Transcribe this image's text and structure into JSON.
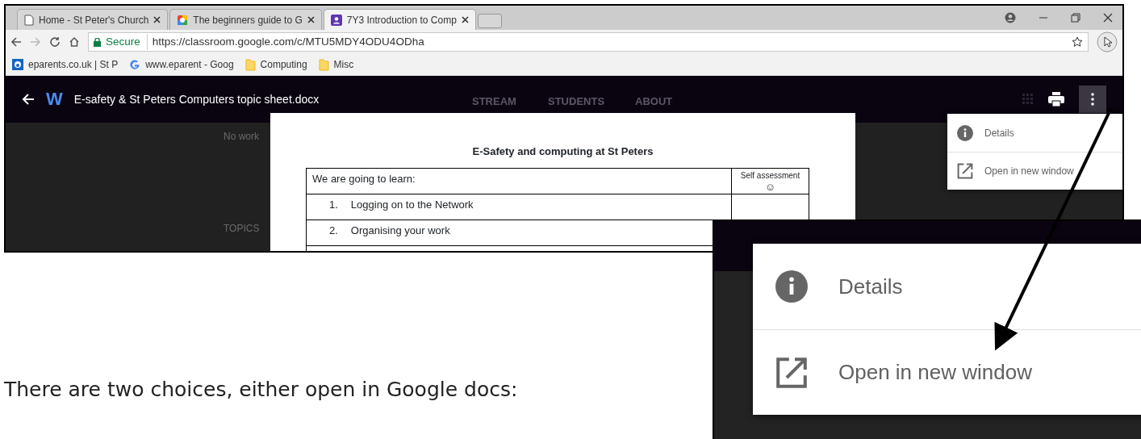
{
  "browser": {
    "tabs": [
      {
        "title": "Home - St Peter's Church",
        "kind": "page",
        "selected": false
      },
      {
        "title": "The beginners guide to G",
        "kind": "logo",
        "selected": false
      },
      {
        "title": "7Y3 Introduction to Comp",
        "kind": "classroom",
        "selected": true
      }
    ],
    "secure_label": "Secure",
    "url": "https://classroom.google.com/c/MTU5MDY4ODU4ODha",
    "bookmarks": [
      {
        "label": "eparents.co.uk | St P",
        "kind": "site"
      },
      {
        "label": "www.eparent - Goog",
        "kind": "google"
      },
      {
        "label": "Computing",
        "kind": "folder"
      },
      {
        "label": "Misc",
        "kind": "folder"
      }
    ]
  },
  "viewer": {
    "file_badge": "W",
    "title": "E-safety & St Peters Computers topic sheet.docx",
    "background_nav": [
      "STREAM",
      "STUDENTS",
      "ABOUT"
    ],
    "background_notice": "No work",
    "background_heading": "TOPICS",
    "document": {
      "heading": "E-Safety and computing at St Peters",
      "intro": "We are going to learn:",
      "assessment_header": "Self assessment",
      "assessment_symbol": "☺",
      "items": [
        {
          "number": "1.",
          "text": "Logging on to the Network"
        },
        {
          "number": "2.",
          "text": "Organising your work"
        }
      ]
    },
    "menu": [
      {
        "label": "Details",
        "kind": "info"
      },
      {
        "label": "Open in new window",
        "kind": "external"
      }
    ]
  },
  "zoomed_menu": [
    {
      "label": "Details",
      "kind": "info"
    },
    {
      "label": "Open in new window",
      "kind": "external"
    }
  ],
  "caption": "There are two choices, either open in Google docs:"
}
